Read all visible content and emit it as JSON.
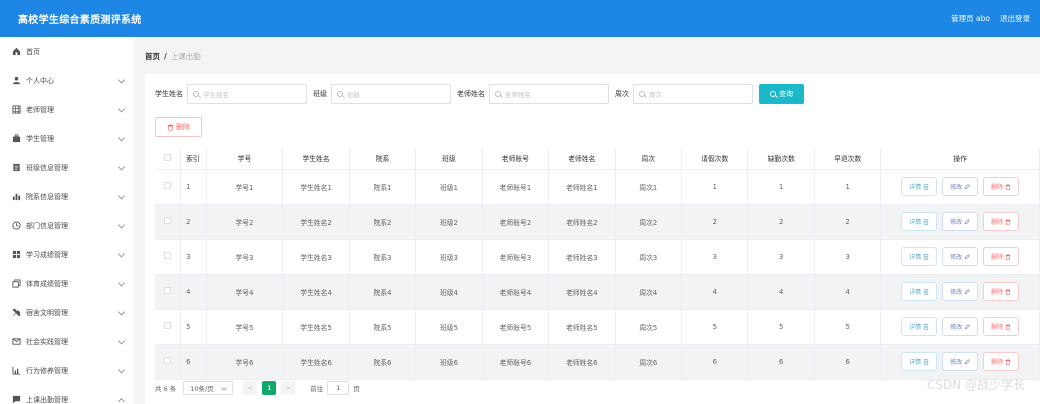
{
  "app": {
    "title": "高校学生综合素质测评系统",
    "admin": "管理员 abo",
    "logout": "退出登录"
  },
  "sidebar": {
    "items": [
      {
        "label": "首页",
        "icon": "home-icon",
        "arrow": ""
      },
      {
        "label": "个人中心",
        "icon": "user-icon",
        "arrow": "down"
      },
      {
        "label": "老师管理",
        "icon": "grid-icon",
        "arrow": "down"
      },
      {
        "label": "学生管理",
        "icon": "briefcase-icon",
        "arrow": "down"
      },
      {
        "label": "班级信息管理",
        "icon": "list-icon",
        "arrow": "down"
      },
      {
        "label": "院系信息管理",
        "icon": "bar-chart-icon",
        "arrow": "down"
      },
      {
        "label": "部门信息管理",
        "icon": "clock-icon",
        "arrow": "down"
      },
      {
        "label": "学习成绩管理",
        "icon": "blocks-icon",
        "arrow": "down"
      },
      {
        "label": "体育成绩管理",
        "icon": "copy-icon",
        "arrow": "down"
      },
      {
        "label": "宿舍文明管理",
        "icon": "tools-icon",
        "arrow": "down"
      },
      {
        "label": "社会实践管理",
        "icon": "mail-icon",
        "arrow": "down"
      },
      {
        "label": "行为修养管理",
        "icon": "chart-icon",
        "arrow": "down"
      },
      {
        "label": "上课出勤管理",
        "icon": "comment-icon",
        "arrow": "up"
      }
    ]
  },
  "breadcrumb": {
    "home": "首页",
    "sep": "/",
    "current": "上课出勤"
  },
  "search": {
    "student_name_label": "学生姓名",
    "student_name_placeholder": "学生姓名",
    "class_label": "班级",
    "class_placeholder": "班级",
    "teacher_name_label": "老师姓名",
    "teacher_name_placeholder": "老师姓名",
    "week_label": "周次",
    "week_placeholder": "周次",
    "button": "查询"
  },
  "actions": {
    "delete": "删除"
  },
  "table": {
    "headers": [
      "索引",
      "学号",
      "学生姓名",
      "院系",
      "班级",
      "老师账号",
      "老师姓名",
      "周次",
      "请假次数",
      "缺勤次数",
      "早退次数",
      "操作"
    ],
    "rows": [
      [
        "1",
        "学号1",
        "学生姓名1",
        "院系1",
        "班级1",
        "老师账号1",
        "老师姓名1",
        "周次1",
        "1",
        "1",
        "1"
      ],
      [
        "2",
        "学号2",
        "学生姓名2",
        "院系2",
        "班级2",
        "老师账号2",
        "老师姓名2",
        "周次2",
        "2",
        "2",
        "2"
      ],
      [
        "3",
        "学号3",
        "学生姓名3",
        "院系3",
        "班级3",
        "老师账号3",
        "老师姓名3",
        "周次3",
        "3",
        "3",
        "3"
      ],
      [
        "4",
        "学号4",
        "学生姓名4",
        "院系4",
        "班级4",
        "老师账号4",
        "老师姓名4",
        "周次4",
        "4",
        "4",
        "4"
      ],
      [
        "5",
        "学号5",
        "学生姓名5",
        "院系5",
        "班级5",
        "老师账号5",
        "老师姓名5",
        "周次5",
        "5",
        "5",
        "5"
      ],
      [
        "6",
        "学号6",
        "学生姓名6",
        "院系6",
        "班级6",
        "老师账号6",
        "老师姓名6",
        "周次6",
        "6",
        "6",
        "6"
      ]
    ],
    "op_detail": "详情",
    "op_edit": "修改",
    "op_delete": "删除"
  },
  "pager": {
    "total": "共 6 条",
    "page_size": "10条/页",
    "prev": "<",
    "page": "1",
    "next": ">",
    "goto": "前往",
    "goto_value": "1",
    "page_unit": "页"
  },
  "watermark": "CSDN @战少学长",
  "colors": {
    "topbar": "#1e87e6",
    "search_button": "#1ab8c8",
    "active_page": "#13a86a",
    "danger": "#f56c6c"
  }
}
